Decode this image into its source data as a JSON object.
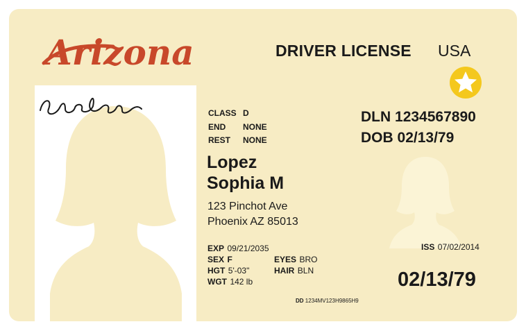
{
  "header": {
    "state_logo_text": "Arizona",
    "document_title": "DRIVER LICENSE",
    "country": "USA"
  },
  "colors": {
    "card_background": "#f7ecc4",
    "logo_red": "#c8482a",
    "star_gold": "#f4c81d",
    "silhouette": "#f7ecc4"
  },
  "license": {
    "class_label": "CLASS",
    "class_value": "D",
    "end_label": "END",
    "end_value": "NONE",
    "rest_label": "REST",
    "rest_value": "NONE",
    "dln_label": "DLN",
    "dln_value": "1234567890",
    "dob_label": "DOB",
    "dob_value": "02/13/79",
    "last_name": "Lopez",
    "first_name": "Sophia M",
    "address_line1": "123 Pinchot Ave",
    "address_line2": "Phoenix AZ 85013",
    "exp_label": "EXP",
    "exp_value": "09/21/2035",
    "sex_label": "SEX",
    "sex_value": "F",
    "eyes_label": "EYES",
    "eyes_value": "BRO",
    "hgt_label": "HGT",
    "hgt_value": "5'-03\"",
    "hair_label": "HAIR",
    "hair_value": "BLN",
    "wgt_label": "WGT",
    "wgt_value": "142 lb",
    "iss_label": "ISS",
    "iss_value": "07/02/2014",
    "big_dob": "02/13/79",
    "dd_label": "DD",
    "dd_value": "1234MV123H9865H9"
  },
  "icons": {
    "real_id_star": "star-icon",
    "signature": "signature-icon",
    "portrait": "portrait-silhouette-icon",
    "ghost_portrait": "ghost-portrait-icon"
  }
}
